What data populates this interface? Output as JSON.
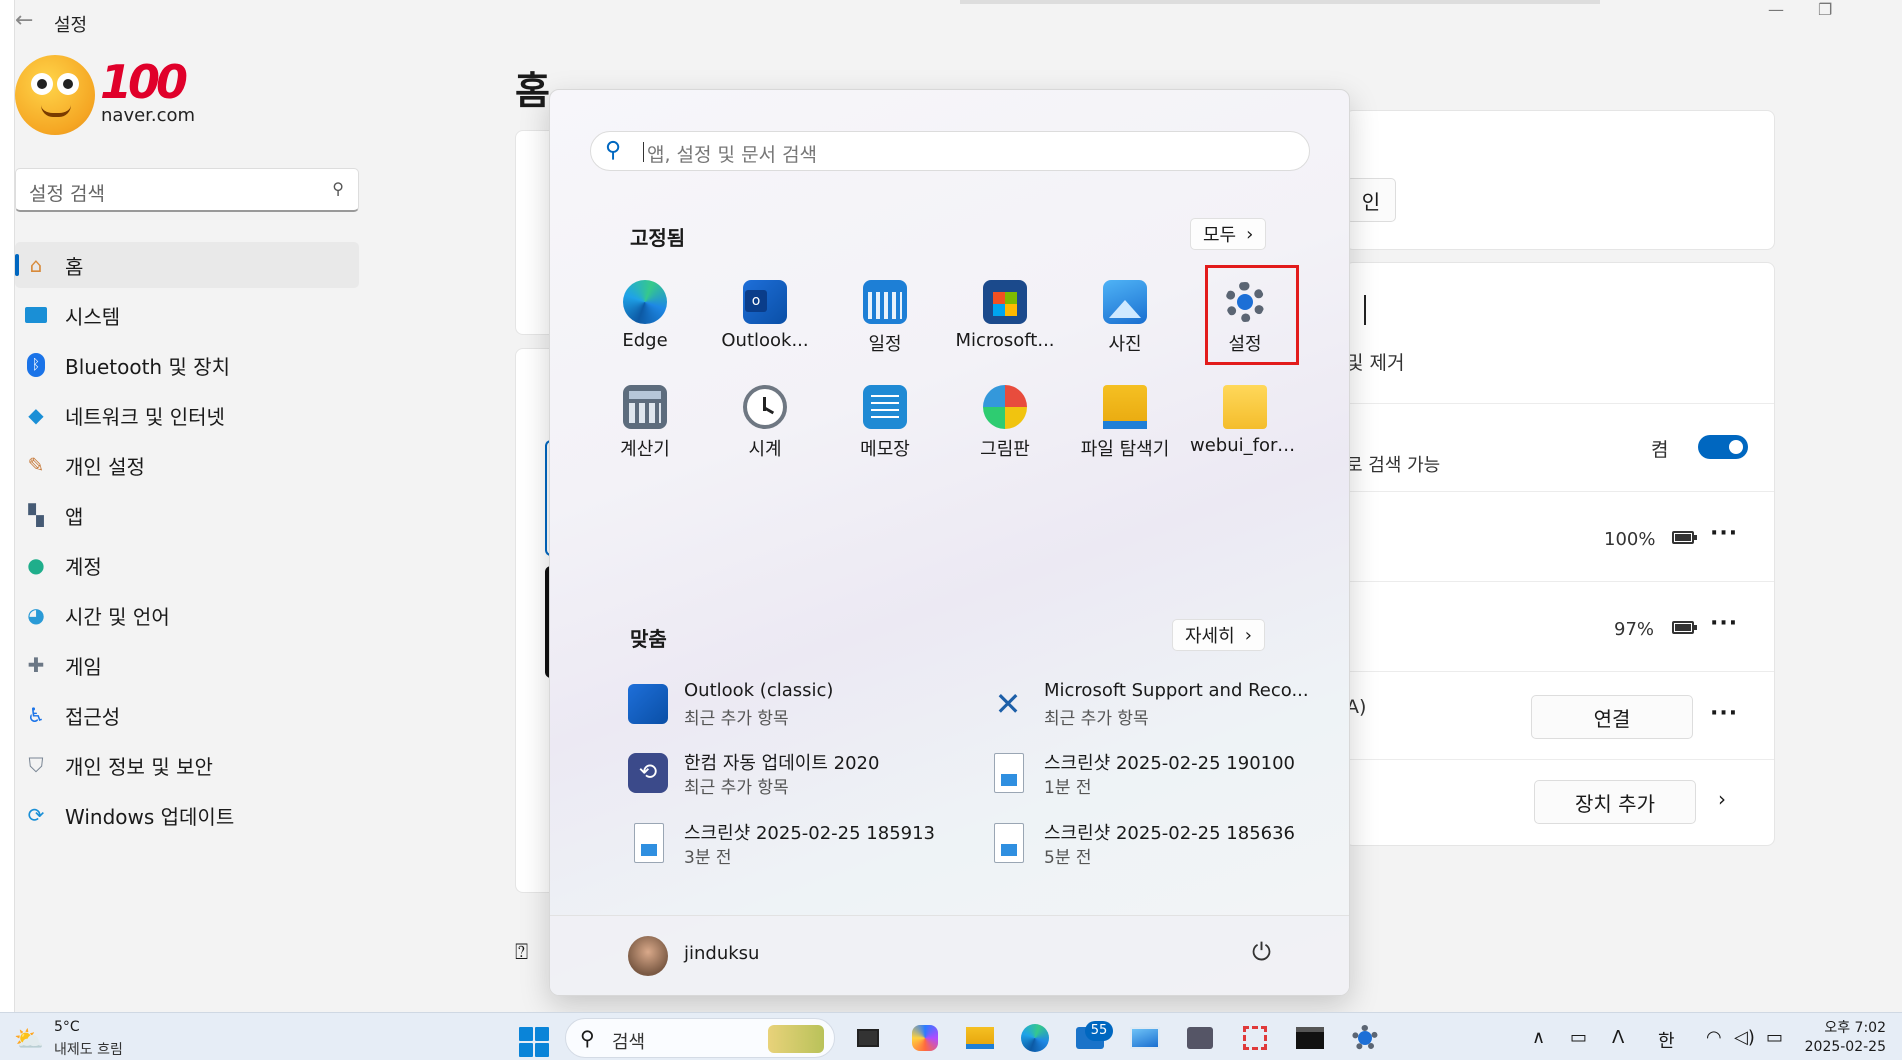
{
  "window": {
    "title": "설정"
  },
  "profile": {
    "badge": "100",
    "email": "naver.com"
  },
  "sidebar": {
    "search_placeholder": "설정 검색",
    "items": [
      {
        "label": "홈",
        "icon": "home-icon",
        "active": true
      },
      {
        "label": "시스템",
        "icon": "system-icon"
      },
      {
        "label": "Bluetooth 및 장치",
        "icon": "bluetooth-icon"
      },
      {
        "label": "네트워크 및 인터넷",
        "icon": "wifi-icon"
      },
      {
        "label": "개인 설정",
        "icon": "brush-icon"
      },
      {
        "label": "앱",
        "icon": "apps-icon"
      },
      {
        "label": "계정",
        "icon": "account-icon"
      },
      {
        "label": "시간 및 언어",
        "icon": "globe-clock-icon"
      },
      {
        "label": "게임",
        "icon": "gamepad-icon"
      },
      {
        "label": "접근성",
        "icon": "accessibility-icon"
      },
      {
        "label": "개인 정보 및 보안",
        "icon": "shield-icon"
      },
      {
        "label": "Windows 업데이트",
        "icon": "update-icon"
      }
    ]
  },
  "main": {
    "page_title": "홈",
    "partial_button": "인",
    "bluetooth_partial": "및 제거",
    "discoverable_partial": "로 검색 가능",
    "toggle_label": "켬",
    "devices": [
      {
        "battery": "100%",
        "fill": 1.0
      },
      {
        "battery": "97%",
        "fill": 0.97
      }
    ],
    "device_a_suffix": "A)",
    "connect_button": "연결",
    "add_device_button": "장치 추가"
  },
  "start": {
    "search_placeholder": "앱, 설정 및 문서 검색",
    "pinned_title": "고정됨",
    "all_button": "모두",
    "pinned": [
      {
        "label": "Edge",
        "icon": "edge-icon"
      },
      {
        "label": "Outlook...",
        "icon": "outlook-icon"
      },
      {
        "label": "일정",
        "icon": "calendar-icon"
      },
      {
        "label": "Microsoft...",
        "icon": "store-icon"
      },
      {
        "label": "사진",
        "icon": "photos-icon"
      },
      {
        "label": "설정",
        "icon": "settings-gear-icon"
      },
      {
        "label": "계산기",
        "icon": "calculator-icon"
      },
      {
        "label": "시계",
        "icon": "clock-icon"
      },
      {
        "label": "메모장",
        "icon": "notepad-icon"
      },
      {
        "label": "그림판",
        "icon": "paint-icon"
      },
      {
        "label": "파일 탐색기",
        "icon": "folder-icon"
      },
      {
        "label": "webui_forge...",
        "icon": "folder-icon"
      }
    ],
    "recommended_title": "맞춤",
    "more_button": "자세히",
    "recommended": [
      {
        "name": "Outlook (classic)",
        "sub": "최근 추가 항목",
        "icon": "outlook-icon"
      },
      {
        "name": "Microsoft Support and Reco...",
        "sub": "최근 추가 항목",
        "icon": "tools-icon"
      },
      {
        "name": "한컴 자동 업데이트 2020",
        "sub": "최근 추가 항목",
        "icon": "hancom-update-icon"
      },
      {
        "name": "스크린샷 2025-02-25 190100",
        "sub": "1분 전",
        "icon": "image-file-icon"
      },
      {
        "name": "스크린샷 2025-02-25 185913",
        "sub": "3분 전",
        "icon": "image-file-icon"
      },
      {
        "name": "스크린샷 2025-02-25 185636",
        "sub": "5분 전",
        "icon": "image-file-icon"
      }
    ],
    "user_name": "jinduksu"
  },
  "taskbar": {
    "weather_temp": "5°C",
    "weather_desc": "내제도 흐림",
    "search_placeholder": "검색",
    "badge_count": "55",
    "ime": "한",
    "time": "오후 7:02",
    "date": "2025-02-25"
  },
  "colors": {
    "accent": "#0067c0",
    "highlight": "#e21b1b"
  }
}
